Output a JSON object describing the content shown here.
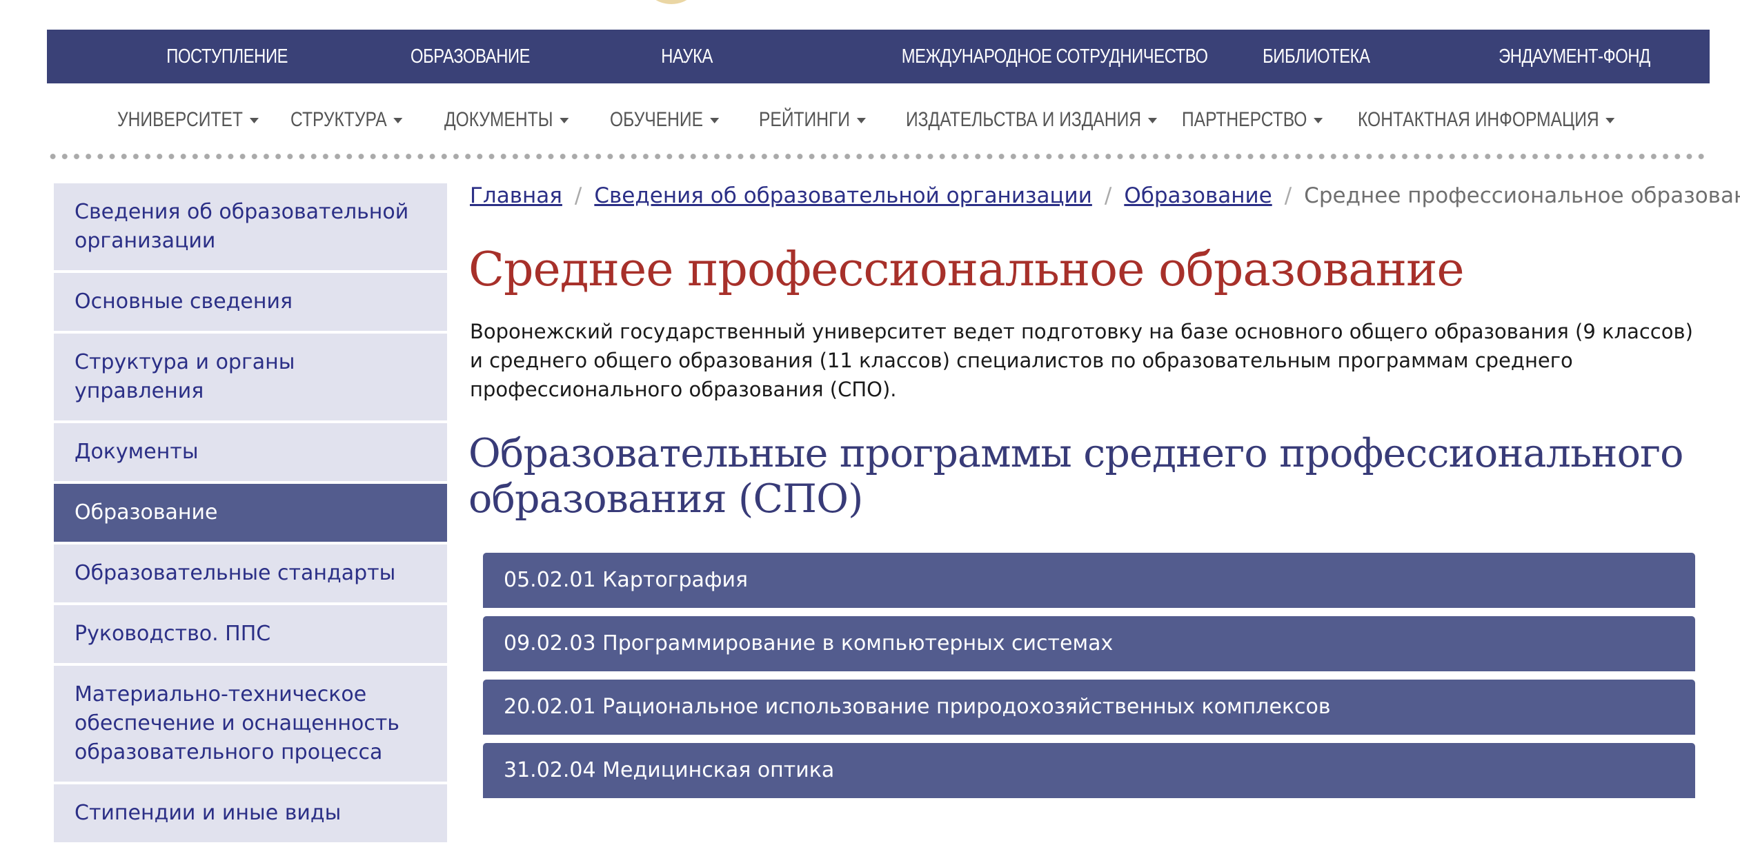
{
  "top_nav": [
    "ПОСТУПЛЕНИЕ",
    "ОБРАЗОВАНИЕ",
    "НАУКА",
    "МЕЖДУНАРОДНОЕ СОТРУДНИЧЕСТВО",
    "БИБЛИОТЕКА",
    "ЭНДАУМЕНТ-ФОНД"
  ],
  "sub_nav": [
    "УНИВЕРСИТЕТ",
    "СТРУКТУРА",
    "ДОКУМЕНТЫ",
    "ОБУЧЕНИЕ",
    "РЕЙТИНГИ",
    "ИЗДАТЕЛЬСТВА И ИЗДАНИЯ",
    "ПАРТНЕРСТВО",
    "КОНТАКТНАЯ ИНФОРМАЦИЯ"
  ],
  "sidebar": {
    "items": [
      {
        "label": "Сведения об образовательной организации",
        "active": false
      },
      {
        "label": "Основные сведения",
        "active": false
      },
      {
        "label": "Структура и органы управления",
        "active": false
      },
      {
        "label": "Документы",
        "active": false
      },
      {
        "label": "Образование",
        "active": true
      },
      {
        "label": "Образовательные стандарты",
        "active": false
      },
      {
        "label": "Руководство. ППС",
        "active": false
      },
      {
        "label": "Материально-техническое обеспечение и оснащенность образовательного процесса",
        "active": false
      },
      {
        "label": "Стипендии и иные виды",
        "active": false
      }
    ]
  },
  "breadcrumb": {
    "items": [
      "Главная",
      "Сведения об образовательной организации",
      "Образование"
    ],
    "current": "Среднее профессиональное образование",
    "separator": "/"
  },
  "page": {
    "title": "Среднее профессиональное образование",
    "intro": "Воронежский государственный университет ведет подготовку на базе основного общего образования (9 классов) и среднего общего образования (11 классов) специалистов по образовательным программам среднего профессионального образования (СПО).",
    "section_title": "Образовательные программы среднего профессионального образования (СПО)"
  },
  "programs": [
    "05.02.01 Картография",
    "09.02.03 Программирование в компьютерных системах",
    "20.02.01 Рациональное использование природохозяйственных комплексов",
    "31.02.04 Медицинская оптика"
  ],
  "colors": {
    "nav_bg": "#3a4177",
    "link": "#2b2f86",
    "title_red": "#a7302a",
    "section_title": "#383b78",
    "sidebar_bg": "#e1e2ee",
    "active_bg": "#535c8e"
  }
}
